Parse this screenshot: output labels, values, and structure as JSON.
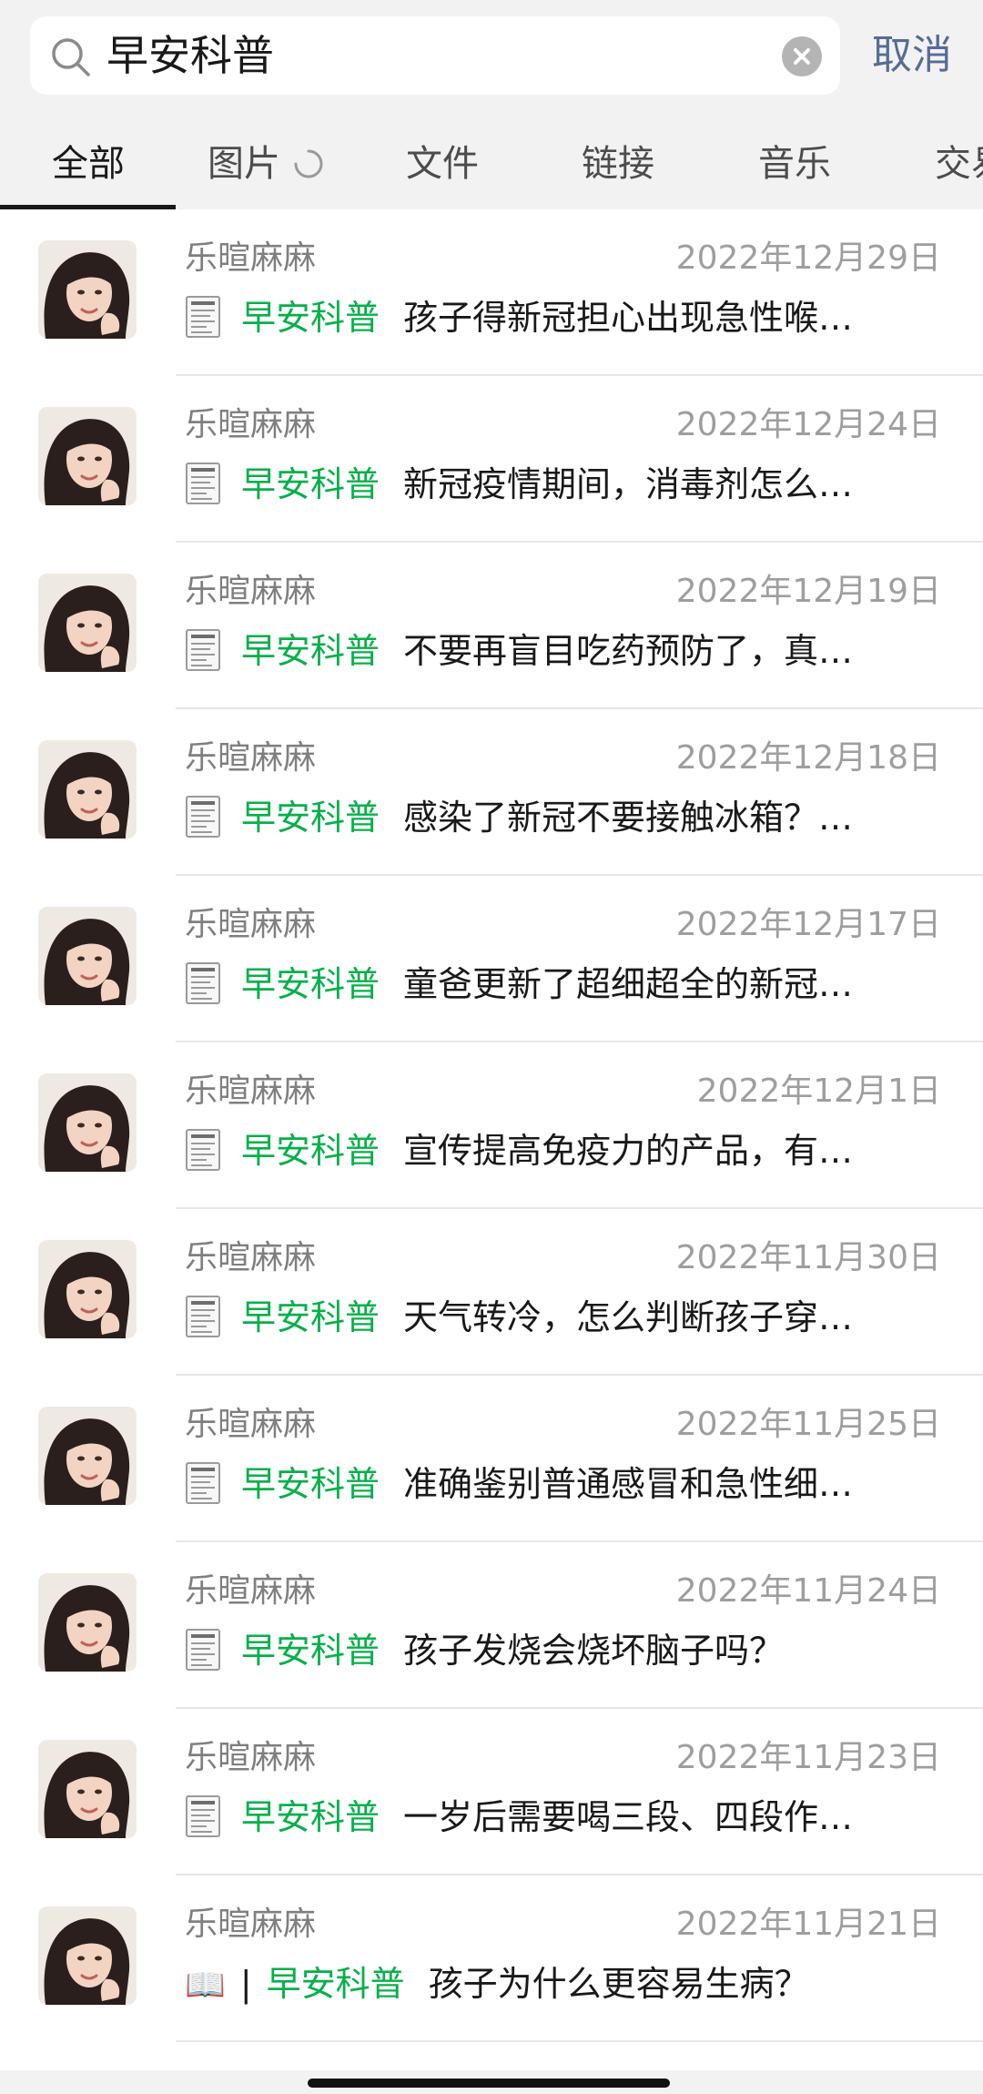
{
  "search": {
    "query": "早安科普",
    "cancel_label": "取消"
  },
  "tabs": [
    {
      "label": "全部"
    },
    {
      "label": "图片"
    },
    {
      "label": "文件"
    },
    {
      "label": "链接"
    },
    {
      "label": "音乐"
    },
    {
      "label": "交易"
    }
  ],
  "active_tab": "全部",
  "keyword": "早安科普",
  "results": [
    {
      "sender": "乐暄麻麻",
      "date": "2022年12月29日",
      "text": "孩子得新冠担心出现急性喉…",
      "icon": "receipt-doc-icon"
    },
    {
      "sender": "乐暄麻麻",
      "date": "2022年12月24日",
      "text": "新冠疫情期间，消毒剂怎么…",
      "icon": "receipt-doc-icon"
    },
    {
      "sender": "乐暄麻麻",
      "date": "2022年12月19日",
      "text": "不要再盲目吃药预防了，真…",
      "icon": "receipt-doc-icon"
    },
    {
      "sender": "乐暄麻麻",
      "date": "2022年12月18日",
      "text": "感染了新冠不要接触冰箱？…",
      "icon": "receipt-doc-icon"
    },
    {
      "sender": "乐暄麻麻",
      "date": "2022年12月17日",
      "text": "童爸更新了超细超全的新冠…",
      "icon": "receipt-doc-icon"
    },
    {
      "sender": "乐暄麻麻",
      "date": "2022年12月1日",
      "text": "宣传提高免疫力的产品，有…",
      "icon": "receipt-doc-icon"
    },
    {
      "sender": "乐暄麻麻",
      "date": "2022年11月30日",
      "text": "天气转冷，怎么判断孩子穿…",
      "icon": "receipt-doc-icon"
    },
    {
      "sender": "乐暄麻麻",
      "date": "2022年11月25日",
      "text": "准确鉴别普通感冒和急性细…",
      "icon": "receipt-doc-icon"
    },
    {
      "sender": "乐暄麻麻",
      "date": "2022年11月24日",
      "text": "孩子发烧会烧坏脑子吗？",
      "icon": "receipt-doc-icon"
    },
    {
      "sender": "乐暄麻麻",
      "date": "2022年11月23日",
      "text": "一岁后需要喝三段、四段作…",
      "icon": "receipt-doc-icon"
    },
    {
      "sender": "乐暄麻麻",
      "date": "2022年11月21日",
      "text": "孩子为什么更容易生病？",
      "icon": "open-book-icon",
      "prefix": "📖",
      "pipe": "|"
    }
  ],
  "colors": {
    "keyword": "#07b04a",
    "cancel": "#576b95"
  }
}
